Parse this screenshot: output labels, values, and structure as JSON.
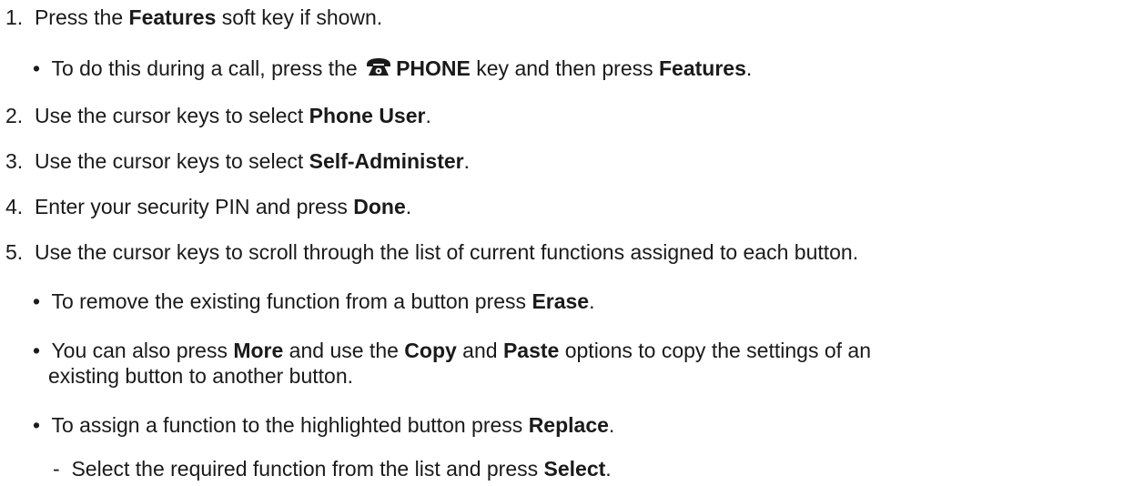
{
  "steps": {
    "s1": {
      "num": "1.",
      "a": "Press the ",
      "b": "Features",
      "c": " soft key if shown."
    },
    "s1b1": {
      "a": "To do this during a call, press the ",
      "b": "PHONE",
      "c": " key and then press ",
      "d": "Features",
      "e": "."
    },
    "s2": {
      "num": "2.",
      "a": "Use the cursor keys to select ",
      "b": "Phone User",
      "c": "."
    },
    "s3": {
      "num": "3.",
      "a": "Use the cursor keys to select ",
      "b": "Self-Administer",
      "c": "."
    },
    "s4": {
      "num": "4.",
      "a": "Enter your security PIN and press ",
      "b": "Done",
      "c": "."
    },
    "s5": {
      "num": "5.",
      "a": "Use the cursor keys to scroll through the list of current functions assigned to each button."
    },
    "s5b1": {
      "a": "To remove the existing function from a button press ",
      "b": "Erase",
      "c": "."
    },
    "s5b2": {
      "a": "You can also press ",
      "b": "More",
      "c": " and use the ",
      "d": "Copy",
      "e": " and ",
      "f": "Paste",
      "g": " options to copy the settings of an",
      "line2": "existing button to another button."
    },
    "s5b3": {
      "a": "To assign a function to the highlighted button press ",
      "b": "Replace",
      "c": "."
    },
    "s5b3d1": {
      "a": "Select the required function from the list and press ",
      "b": "Select",
      "c": "."
    }
  },
  "bullet": "•",
  "dash": "-",
  "icons": {
    "phone_key": "phone-icon"
  }
}
